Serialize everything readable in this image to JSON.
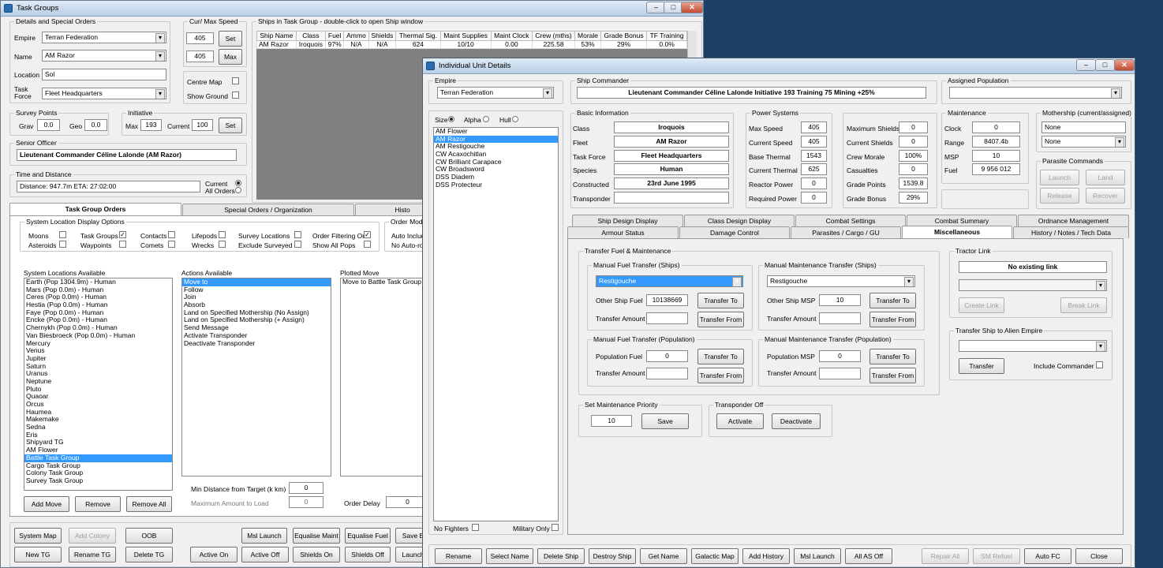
{
  "tg": {
    "title": "Task Groups",
    "details_legend": "Details and Special Orders",
    "empire_label": "Empire",
    "empire_value": "Terran Federation",
    "name_label": "Name",
    "name_value": "AM Razor",
    "location_label": "Location",
    "location_value": "Sol",
    "taskforce_label": "Task Force",
    "taskforce_value": "Fleet Headquarters",
    "speed_legend": "Cur/ Max Speed",
    "cur_speed": "405",
    "max_speed": "405",
    "set_label": "Set",
    "max_label": "Max",
    "centre_map": "Centre Map",
    "show_ground": "Show Ground",
    "ships_legend": "Ships in Task Group - double-click to open Ship window",
    "ship_cols": [
      "Ship Name",
      "Class",
      "Fuel",
      "Ammo",
      "Shields",
      "Thermal Sig.",
      "Maint Supplies",
      "Maint Clock",
      "Crew (mths)",
      "Morale",
      "Grade Bonus",
      "TF Training"
    ],
    "ship_row": [
      "AM Razor",
      "Iroquois",
      "97%",
      "N/A",
      "N/A",
      "624",
      "10/10",
      "0.00",
      "225.58",
      "53%",
      "29%",
      "0.0%"
    ],
    "survey_legend": "Survey Points",
    "grav_label": "Grav",
    "grav_value": "0.0",
    "geo_label": "Geo",
    "geo_value": "0.0",
    "init_legend": "Initiative",
    "init_max_label": "Max",
    "init_max": "193",
    "init_current_label": "Current",
    "init_current": "100",
    "init_set": "Set",
    "senior_legend": "Senior Officer",
    "senior_value": "Lieutenant Commander Céline Lalonde (AM Razor)",
    "time_legend": "Time and Distance",
    "distance_value": "Distance: 947.7m  ETA: 27:02:00",
    "current_label": "Current",
    "all_orders_label": "All Orders",
    "tabs": [
      "Task Group Orders",
      "Special Orders / Organization",
      "Histo"
    ],
    "sysloc_legend": "System Location Display Options",
    "opts": [
      "Moons",
      "Asteroids",
      "Task Groups",
      "Waypoints",
      "Contacts",
      "Comets",
      "Lifepods",
      "Wrecks",
      "Survey Locations",
      "Exclude Surveyed",
      "Order Filtering On",
      "Show All Pops"
    ],
    "order_mod_legend": "Order Modific",
    "auto_include": "Auto Includ",
    "no_auto": "No Auto-rou",
    "sys_avail_label": "System Locations Available",
    "systems": [
      "Earth  (Pop 1304.9m) - Human",
      "Mars  (Pop 0.0m) - Human",
      "Ceres  (Pop 0.0m) - Human",
      "Hestia  (Pop 0.0m) - Human",
      "Faye  (Pop 0.0m) - Human",
      "Encke  (Pop 0.0m) - Human",
      "Chernykh  (Pop 0.0m) - Human",
      "Van Biesbroeck  (Pop 0.0m) - Human",
      "Mercury",
      "Venus",
      "Jupiter",
      "Saturn",
      "Uranus",
      "Neptune",
      "Pluto",
      "Quaoar",
      "Orcus",
      "Haumea",
      "Makemake",
      "Sedna",
      "Eris",
      " Shipyard TG",
      "AM Flower",
      "Battle Task Group",
      "Cargo Task Group",
      "Colony Task Group",
      "Survey Task Group"
    ],
    "actions_label": "Actions Available",
    "actions": [
      "Move to",
      "Follow",
      "Join",
      "Absorb",
      "Land on Specified Mothership (No Assign)",
      "Land on Specified Mothership (+ Assign)",
      "Send Message",
      "Activate Transponder",
      "Deactivate Transponder"
    ],
    "plotted_label": "Plotted Move",
    "plotted": [
      "Move to Battle Task Group"
    ],
    "add_move": "Add Move",
    "remove": "Remove",
    "remove_all": "Remove All",
    "min_dist_label": "Min Distance from Target (k km)",
    "min_dist": "0",
    "max_load_label": "Maximum Amount to Load",
    "max_load": "0",
    "order_delay_label": "Order Delay",
    "order_delay": "0",
    "bottom_row1": [
      "System Map",
      "Add Colony",
      "OOB",
      "Msl Launch",
      "Equalise Maint",
      "Equalise Fuel",
      "Save E"
    ],
    "bottom_row2": [
      "New TG",
      "Rename TG",
      "Delete TG",
      "Active On",
      "Active Off",
      "Shields On",
      "Shields Off",
      "Launch"
    ]
  },
  "iud": {
    "title": "Individual Unit Details",
    "empire_legend": "Empire",
    "empire_value": "Terran Federation",
    "size_label": "Size",
    "alpha_label": "Alpha",
    "hull_label": "Hull",
    "ships": [
      "AM Flower",
      "AM Razor",
      "AM Restigouche",
      "CW Acaxochitlan",
      "CW Brilliant Carapace",
      "CW Broadsword",
      "DSS Diadem",
      "DSS Protecteur"
    ],
    "no_fighters": "No Fighters",
    "military_only": "Military Only",
    "commander_legend": "Ship Commander",
    "commander_value": "Lieutenant Commander Céline Lalonde   Initiative 193  Training 75  Mining +25%",
    "assigned_pop_legend": "Assigned Population",
    "basic_legend": "Basic Information",
    "class_label": "Class",
    "class_value": "Iroquois",
    "fleet_label": "Fleet",
    "fleet_value": "AM Razor",
    "tf_label": "Task Force",
    "tf_value": "Fleet Headquarters",
    "species_label": "Species",
    "species_value": "Human",
    "constructed_label": "Constructed",
    "constructed_value": "23rd June 1995",
    "transponder_label": "Transponder",
    "power_legend": "Power Systems",
    "max_speed_label": "Max Speed",
    "max_speed": "405",
    "cur_speed_label": "Current Speed",
    "cur_speed": "405",
    "base_thermal_label": "Base Thermal",
    "base_thermal": "1543",
    "cur_thermal_label": "Current Thermal",
    "cur_thermal": "625",
    "reactor_label": "Reactor Power",
    "reactor": "0",
    "req_power_label": "Required Power",
    "req_power": "0",
    "max_shields_label": "Maximum Shields",
    "max_shields": "0",
    "cur_shields_label": "Current Shields",
    "cur_shields": "0",
    "crew_morale_label": "Crew Morale",
    "crew_morale": "100%",
    "casualties_label": "Casualties",
    "casualties": "0",
    "grade_points_label": "Grade Points",
    "grade_points": "1539.8",
    "grade_bonus_label": "Grade Bonus",
    "grade_bonus": "29%",
    "maint_legend": "Maintenance",
    "clock_label": "Clock",
    "clock": "0",
    "range_label": "Range",
    "range": "8407.4b",
    "msp_label": "MSP",
    "msp": "10",
    "fuel_label": "Fuel",
    "fuel": "9 956 012",
    "mothership_legend": "Mothership (current/assigned)",
    "mother_current": "None",
    "mother_assigned": "None",
    "parasite_legend": "Parasite Commands",
    "launch": "Launch",
    "land": "Land",
    "release": "Release",
    "recover": "Recover",
    "tabs_top": [
      "Ship Design Display",
      "Class Design Display",
      "Combat Settings",
      "Combat Summary",
      "Ordnance Management"
    ],
    "tabs_bottom": [
      "Armour Status",
      "Damage Control",
      "Parasites / Cargo / GU",
      "Miscellaneous",
      "History / Notes / Tech Data"
    ],
    "transfer_legend": "Transfer Fuel & Maintenance",
    "mft_ships_legend": "Manual Fuel Transfer (Ships)",
    "mft_ships_select": "Restigouche",
    "other_fuel_label": "Other Ship Fuel",
    "other_fuel": "10138669",
    "transfer_amount_label": "Transfer Amount",
    "transfer_to": "Transfer To",
    "transfer_from": "Transfer From",
    "mmt_ships_legend": "Manual Maintenance Transfer (Ships)",
    "mmt_ships_select": "Restigouche",
    "other_msp_label": "Other Ship MSP",
    "other_msp": "10",
    "mft_pop_legend": "Manual Fuel Transfer (Population)",
    "pop_fuel_label": "Population Fuel",
    "pop_fuel": "0",
    "mmt_pop_legend": "Manual Maintenance Transfer (Population)",
    "pop_msp_label": "Population MSP",
    "pop_msp": "0",
    "maint_priority_legend": "Set Maintenance Priority",
    "maint_priority": "10",
    "save": "Save",
    "transponder_legend": "Transponder Off",
    "activate": "Activate",
    "deactivate": "Deactivate",
    "tractor_legend": "Tractor Link",
    "tractor_value": "No existing link",
    "create_link": "Create Link",
    "break_link": "Break Link",
    "alien_legend": "Transfer Ship to Alien Empire",
    "transfer": "Transfer",
    "include_commander": "Include Commander",
    "bottom": [
      "Rename",
      "Select Name",
      "Delete Ship",
      "Destroy Ship",
      "Get Name",
      "Galactic Map",
      "Add History",
      "Msl Launch",
      "All AS Off",
      "Repair All",
      "SM Refuel",
      "Auto FC",
      "Close"
    ]
  }
}
